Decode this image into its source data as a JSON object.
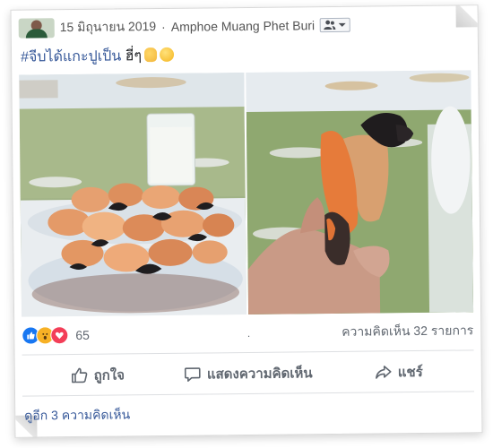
{
  "post": {
    "date": "15 มิถุนายน 2019",
    "separator": "·",
    "location": "Amphoe Muang Phet Buri",
    "caption_tag": "#จีบได้แกะปูเป็น",
    "caption_text": " ฮี่ๆ",
    "privacy_icon": "friends-icon"
  },
  "stats": {
    "reactions": [
      "like",
      "wow",
      "love"
    ],
    "reaction_count": "65",
    "dot": ".",
    "comments": "ความคิดเห็น 32 รายการ"
  },
  "actions": {
    "like": "ถูกใจ",
    "comment": "แสดงความคิดเห็น",
    "share": "แชร์"
  },
  "more_comments": "ดูอีก 3 ความคิดเห็น",
  "colors": {
    "link": "#365899",
    "muted": "#606770",
    "like": "#1877f2",
    "love": "#f33e58",
    "wow": "#f7b125"
  }
}
